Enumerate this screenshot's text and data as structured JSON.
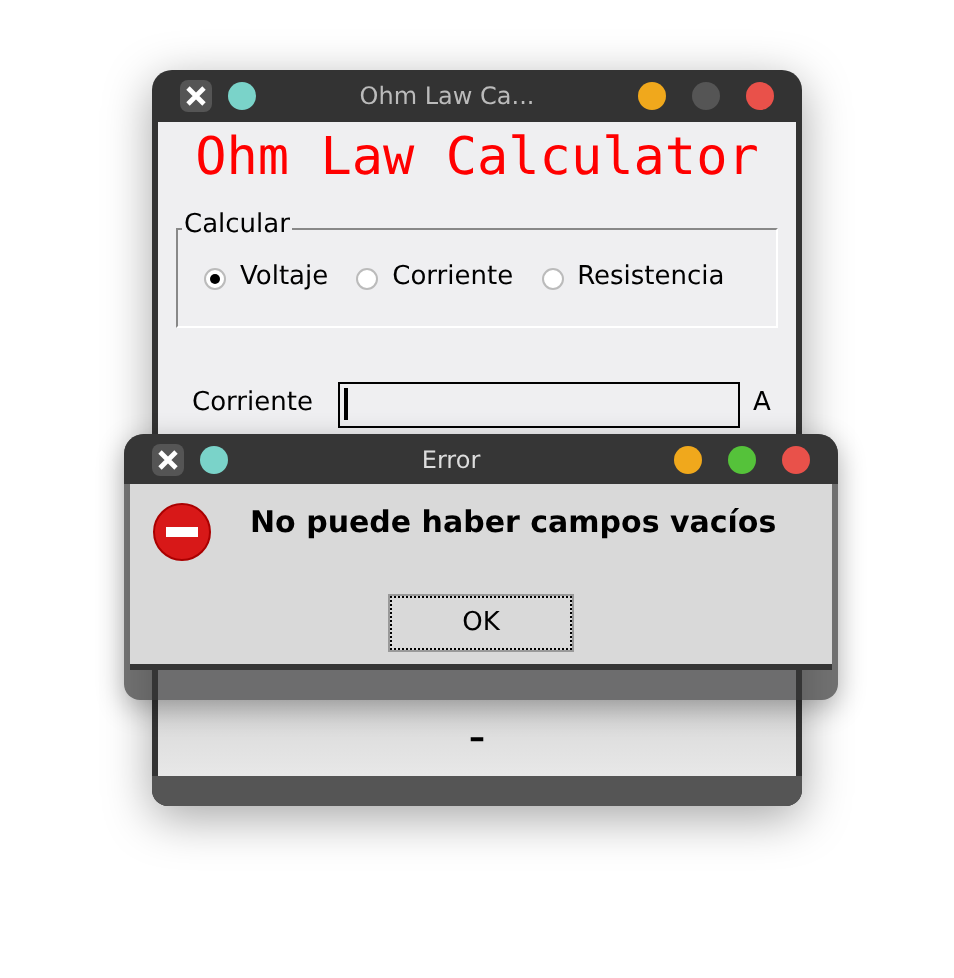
{
  "main_window": {
    "title": "Ohm Law Ca...",
    "heading": "Ohm Law Calculator",
    "group": {
      "label": "Calcular",
      "options": [
        {
          "label": "Voltaje",
          "selected": true
        },
        {
          "label": "Corriente",
          "selected": false
        },
        {
          "label": "Resistencia",
          "selected": false
        }
      ]
    },
    "field": {
      "label": "Corriente",
      "unit": "A",
      "focused": true
    },
    "result": "–"
  },
  "dialog": {
    "title": "Error",
    "message": "No puede haber campos vacíos",
    "button": "OK"
  }
}
